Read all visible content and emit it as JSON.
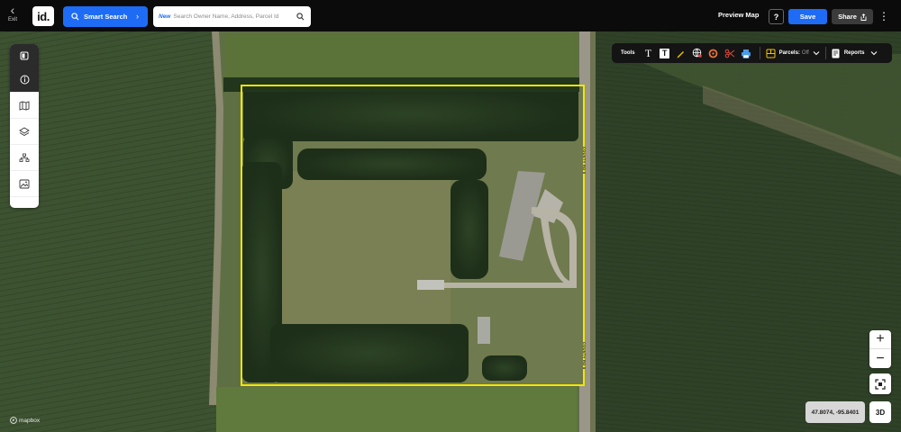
{
  "topbar": {
    "exit_label": "Exit",
    "logo_text": "id.",
    "smart_search_label": "Smart Search",
    "search_new_badge": "New",
    "search_placeholder": "Search Owner Name, Address, Parcel Id",
    "preview_map_label": "Preview Map",
    "help_label": "?",
    "save_label": "Save",
    "share_label": "Share"
  },
  "toolbar": {
    "tools_label": "Tools",
    "parcels_label": "Parcels:",
    "parcels_state": "Off",
    "reports_label": "Reports"
  },
  "map": {
    "road_label_1": "COUNTY RD 5",
    "road_label_2": "COUNTY RD 5",
    "coordinates": "47.8074, -95.8401",
    "three_d_label": "3D",
    "attribution": "mapbox",
    "zoom_in": "+",
    "zoom_out": "−",
    "boundary_color": "#f2e600"
  },
  "colors": {
    "accent": "#1e6cf5",
    "topbar_bg": "#0b0b0b"
  },
  "sidebar": {
    "items": [
      "collapse-panel",
      "info",
      "map",
      "layers",
      "hierarchy",
      "image"
    ]
  }
}
